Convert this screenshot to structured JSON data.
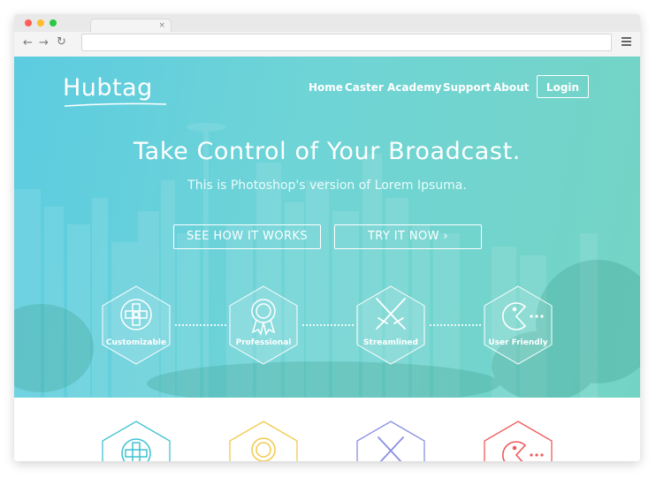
{
  "browser": {
    "tab_close": "×",
    "back_icon": "←",
    "forward_icon": "→",
    "reload_icon": "↻",
    "traffic_lights": [
      "#ff5f57",
      "#febc2e",
      "#28c840"
    ]
  },
  "site": {
    "logo": "Hubtag",
    "nav": {
      "items": [
        "Home",
        "Caster",
        "Academy",
        "Support",
        "About"
      ],
      "login_label": "Login"
    },
    "hero": {
      "headline": "Take Control of Your Broadcast.",
      "subheadline": "This is Photoshop's version  of Lorem Ipsuma.",
      "buttons": {
        "primary_label": "SEE HOW IT WORKS",
        "secondary_label": "TRY IT NOW ›"
      }
    },
    "features": [
      {
        "label": "Customizable",
        "icon": "gamepad-icon"
      },
      {
        "label": "Professional",
        "icon": "award-ribbon-icon"
      },
      {
        "label": "Streamlined",
        "icon": "crossed-swords-icon"
      },
      {
        "label": "User Friendly",
        "icon": "pacman-icon"
      }
    ],
    "feature_colors": [
      "#3fc2d0",
      "#f2c94c",
      "#8a8fe6",
      "#ef5a5a"
    ]
  }
}
